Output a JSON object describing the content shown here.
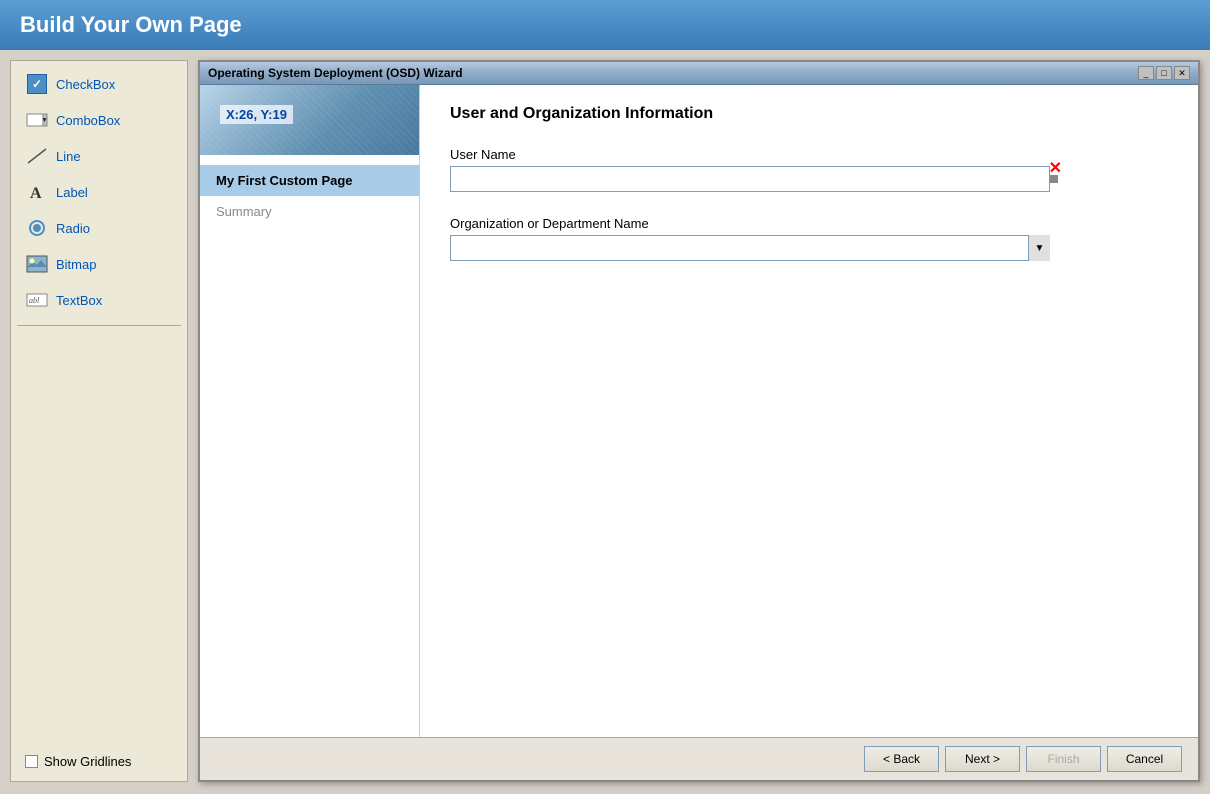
{
  "header": {
    "title": "Build Your Own Page"
  },
  "toolbox": {
    "items": [
      {
        "id": "checkbox",
        "label": "CheckBox",
        "icon": "checkbox-icon"
      },
      {
        "id": "combobox",
        "label": "ComboBox",
        "icon": "combobox-icon"
      },
      {
        "id": "line",
        "label": "Line",
        "icon": "line-icon"
      },
      {
        "id": "label",
        "label": "Label",
        "icon": "label-icon"
      },
      {
        "id": "radio",
        "label": "Radio",
        "icon": "radio-icon"
      },
      {
        "id": "bitmap",
        "label": "Bitmap",
        "icon": "bitmap-icon"
      },
      {
        "id": "textbox",
        "label": "TextBox",
        "icon": "textbox-icon"
      }
    ],
    "show_gridlines_label": "Show Gridlines"
  },
  "wizard": {
    "title": "Operating System Deployment (OSD) Wizard",
    "coords": "X:26, Y:19",
    "nav_items": [
      {
        "label": "My First Custom Page",
        "active": true
      },
      {
        "label": "Summary",
        "active": false
      }
    ],
    "form": {
      "title": "User and Organization Information",
      "fields": [
        {
          "id": "username",
          "label": "User Name",
          "type": "text",
          "value": ""
        },
        {
          "id": "orgname",
          "label": "Organization or Department Name",
          "type": "select",
          "value": ""
        }
      ]
    },
    "buttons": {
      "back": "< Back",
      "next": "Next >",
      "finish": "Finish",
      "cancel": "Cancel"
    }
  }
}
